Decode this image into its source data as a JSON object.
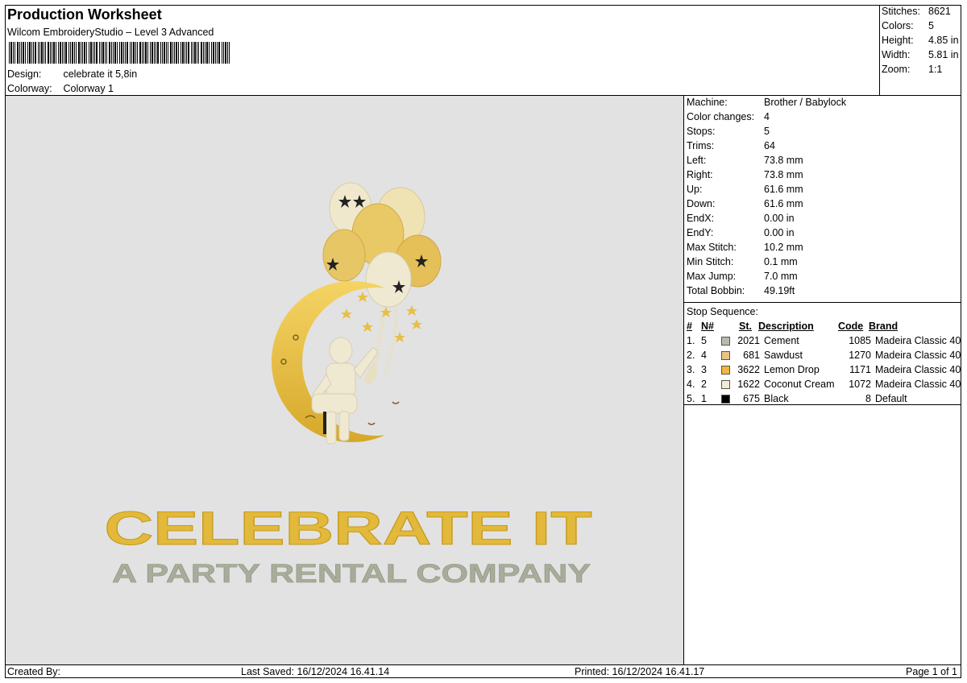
{
  "header": {
    "title": "Production Worksheet",
    "software": "Wilcom EmbroideryStudio – Level 3 Advanced",
    "design_label": "Design:",
    "design_value": "celebrate it 5,8in",
    "colorway_label": "Colorway:",
    "colorway_value": "Colorway 1"
  },
  "stats": [
    {
      "label": "Stitches:",
      "value": "8621"
    },
    {
      "label": "Colors:",
      "value": "5"
    },
    {
      "label": "Height:",
      "value": "4.85 in"
    },
    {
      "label": "Width:",
      "value": "5.81 in"
    },
    {
      "label": "Zoom:",
      "value": "1:1"
    }
  ],
  "machine_info": [
    {
      "label": "Machine:",
      "value": "Brother / Babylock"
    },
    {
      "label": "Color changes:",
      "value": "4"
    },
    {
      "label": "Stops:",
      "value": "5"
    },
    {
      "label": "Trims:",
      "value": "64"
    },
    {
      "label": "Left:",
      "value": "73.8 mm"
    },
    {
      "label": "Right:",
      "value": "73.8 mm"
    },
    {
      "label": "Up:",
      "value": "61.6 mm"
    },
    {
      "label": "Down:",
      "value": "61.6 mm"
    },
    {
      "label": "EndX:",
      "value": "0.00 in"
    },
    {
      "label": "EndY:",
      "value": "0.00 in"
    },
    {
      "label": "Max Stitch:",
      "value": "10.2 mm"
    },
    {
      "label": "Min Stitch:",
      "value": "0.1 mm"
    },
    {
      "label": "Max Jump:",
      "value": "7.0 mm"
    },
    {
      "label": "Total Bobbin:",
      "value": "49.19ft"
    }
  ],
  "stop_sequence": {
    "title": "Stop Sequence:",
    "headers": {
      "idx": "#",
      "n": "N#",
      "st": "St.",
      "desc": "Description",
      "code": "Code",
      "brand": "Brand"
    },
    "rows": [
      {
        "idx": "1.",
        "n": "5",
        "st": "2021",
        "desc": "Cement",
        "code": "1085",
        "brand": "Madeira Classic 40",
        "color": "#b8b9ad"
      },
      {
        "idx": "2.",
        "n": "4",
        "st": "681",
        "desc": "Sawdust",
        "code": "1270",
        "brand": "Madeira Classic 40",
        "color": "#e9c487"
      },
      {
        "idx": "3.",
        "n": "3",
        "st": "3622",
        "desc": "Lemon Drop",
        "code": "1171",
        "brand": "Madeira Classic 40",
        "color": "#f0b73a"
      },
      {
        "idx": "4.",
        "n": "2",
        "st": "1622",
        "desc": "Coconut Cream",
        "code": "1072",
        "brand": "Madeira Classic 40",
        "color": "#f1ead6"
      },
      {
        "idx": "5.",
        "n": "1",
        "st": "675",
        "desc": "Black",
        "code": "8",
        "brand": "Default",
        "color": "#000000"
      }
    ]
  },
  "design": {
    "headline": "CELEBRATE IT",
    "tagline": "A PARTY RENTAL COMPANY",
    "canvas_color": "#e2e2e2",
    "gold": "#e2b93a",
    "cream": "#ede6ca",
    "sage": "#a7ad9a"
  },
  "footer": {
    "created_by": "Created By:",
    "last_saved": "Last Saved: 16/12/2024 16.41.14",
    "printed": "Printed: 16/12/2024 16.41.17",
    "page": "Page 1 of 1"
  }
}
